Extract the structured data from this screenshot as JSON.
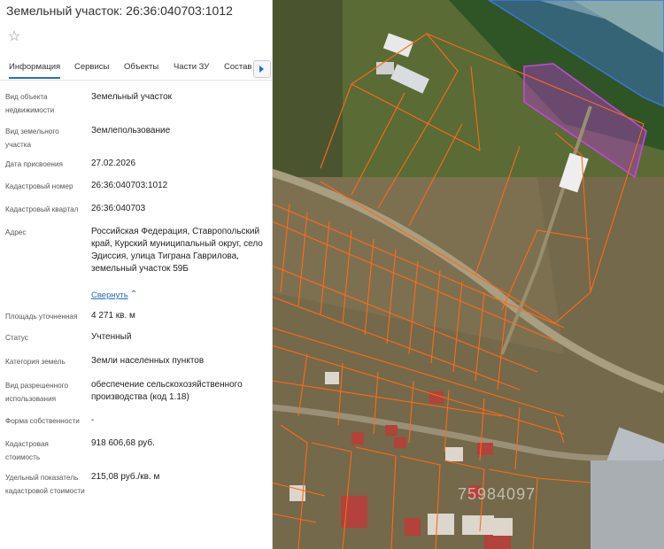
{
  "header": {
    "title": "Земельный участок: 26:36:040703:1012"
  },
  "tabs": [
    {
      "label": "Информация"
    },
    {
      "label": "Сервисы"
    },
    {
      "label": "Объекты"
    },
    {
      "label": "Части ЗУ"
    },
    {
      "label": "Состав"
    }
  ],
  "properties": [
    {
      "label": "Вид объекта недвижимости",
      "value": "Земельный участок"
    },
    {
      "label": "Вид земельного участка",
      "value": "Землепользование"
    },
    {
      "label": "Дата присвоения",
      "value": "27.02.2026"
    },
    {
      "label": "Кадастровый номер",
      "value": "26:36:040703:1012"
    },
    {
      "label": "Кадастровый квартал",
      "value": "26:36:040703"
    },
    {
      "label": "Адрес",
      "value": "Российская Федерация, Ставропольский край, Курский муниципальный округ, село Эдиссия, улица Тиграна Гаврилова, земельный участок 59Б"
    },
    {
      "label": "Площадь уточненная",
      "value": "4 271 кв. м"
    },
    {
      "label": "Статус",
      "value": "Учтенный"
    },
    {
      "label": "Категория земель",
      "value": "Земли населенных пунктов"
    },
    {
      "label": "Вид разрешенного использования",
      "value": "обеспечение сельскохозяйственного производства (код 1.18)"
    },
    {
      "label": "Форма собственности",
      "value": "-"
    },
    {
      "label": "Кадастровая стоимость",
      "value": "918 606,68 руб."
    },
    {
      "label": "Удельный показатель кадастровой стоимости",
      "value": "215,08 руб./кв. м"
    }
  ],
  "address_toggle": "Свернуть",
  "icons": {
    "favorite": "star-outline-icon",
    "tabs_scroll": "chevron-right-icon",
    "collapse": "chevron-up-icon"
  },
  "map": {
    "watermark": "75984097"
  },
  "colors": {
    "accent": "#2a66c9",
    "parcel_border": "#ff6a1a",
    "selected_parcel": "#b23cc8",
    "water_zone": "#3b78d8"
  }
}
